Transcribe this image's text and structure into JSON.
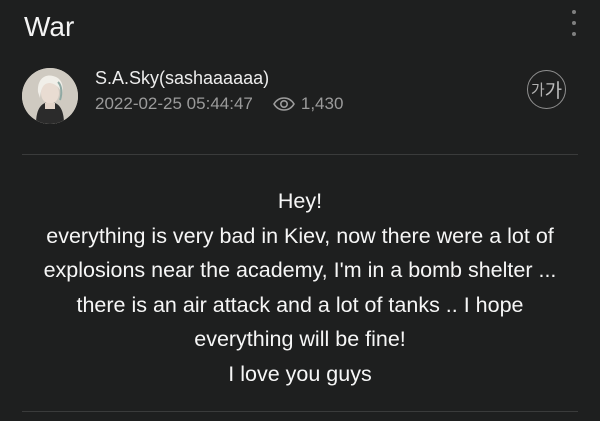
{
  "header": {
    "title": "War",
    "more_icon": "vertical-ellipsis-icon"
  },
  "post": {
    "author": "S.A.Sky(sashaaaaaa)",
    "datetime": "2022-02-25 05:44:47",
    "views": "1,430",
    "font_size_label_small": "가",
    "font_size_label_large": "가",
    "body_lines": [
      "Hey!",
      "everything is very bad in Kiev, now there were a lot of",
      "explosions near the academy, I'm in a bomb shelter ...",
      "there is an air attack and a lot of tanks .. I hope",
      "everything will be fine!",
      "I love you guys"
    ]
  },
  "colors": {
    "background": "#1e1f1f",
    "text": "#f6f6f6",
    "muted": "#9b9b9b",
    "divider": "#3a3b3b"
  }
}
